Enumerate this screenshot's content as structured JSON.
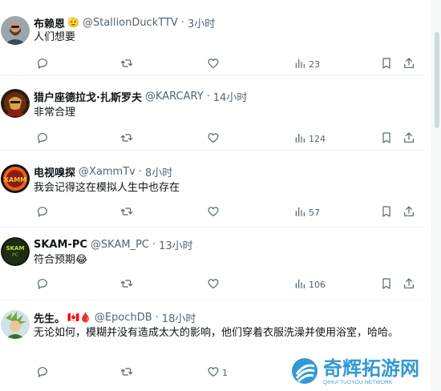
{
  "tweets": [
    {
      "name": "布赖恩",
      "name_emoji": "🫡",
      "handle": "@StallionDuckTTV",
      "separator": "·",
      "time": "3小时",
      "text": "人们想要",
      "counts": {
        "reply": "",
        "retweet": "",
        "like": "",
        "views": "23"
      },
      "avatar": "avatar-man-beard"
    },
    {
      "name": "猎户座德拉戈·扎斯罗夫",
      "name_emoji": "",
      "handle": "@KARCARY",
      "separator": "·",
      "time": "14小时",
      "text": "非常合理",
      "counts": {
        "reply": "",
        "retweet": "",
        "like": "",
        "views": "124"
      },
      "avatar": "avatar-superhero"
    },
    {
      "name": "电视嗅探",
      "name_emoji": "",
      "handle": "@XammTv",
      "separator": "·",
      "time": "8小时",
      "text": "我会记得这在模拟人生中也存在",
      "counts": {
        "reply": "",
        "retweet": "",
        "like": "",
        "views": "57"
      },
      "avatar": "avatar-logo-xamm"
    },
    {
      "name": "SKAM-PC",
      "name_emoji": "",
      "handle": "@SKAM_PC",
      "separator": "·",
      "time": "13小时",
      "text": "符合预期😂",
      "counts": {
        "reply": "",
        "retweet": "",
        "like": "",
        "views": "106"
      },
      "avatar": "avatar-skam-logo"
    },
    {
      "name": "先生。",
      "name_emoji": "🇨🇦🩸",
      "handle": "@EpochDB",
      "separator": "·",
      "time": "18小时",
      "text": "无论如何，模糊并没有造成太大的影响，他们穿着衣服洗澡并使用浴室，哈哈。",
      "counts": {
        "reply": "",
        "retweet": "",
        "like": "1",
        "views": ""
      },
      "avatar": "avatar-anime-character"
    }
  ],
  "watermark": {
    "cn": "奇辉拓游网",
    "en": "QIHUI TUOYOU NETWORK"
  },
  "colors": {
    "text_primary": "#0f1419",
    "text_secondary": "#536471",
    "divider": "#eff3f4",
    "watermark": "#1d8fd1"
  }
}
